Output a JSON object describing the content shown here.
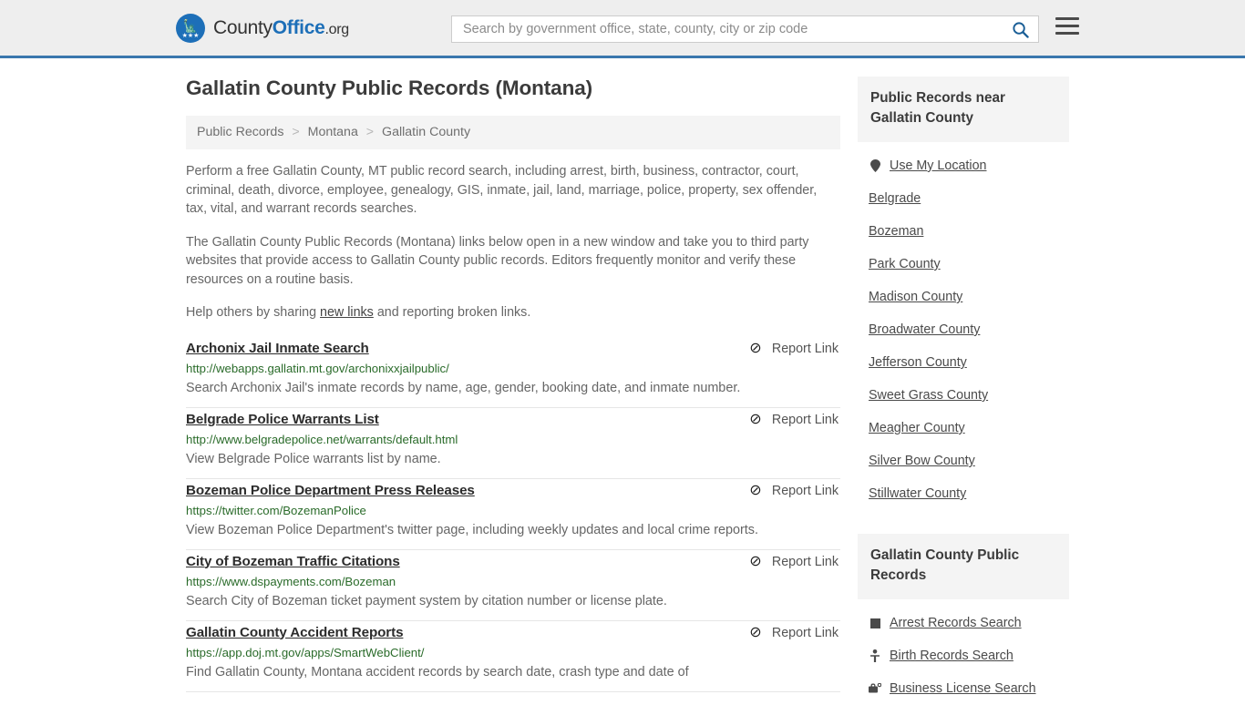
{
  "header": {
    "brand": {
      "part1": "County",
      "part2": "Office",
      "part3": ".org",
      "logo_icon": "eagle-seal-icon",
      "stars": "★★★"
    },
    "search": {
      "value": "",
      "placeholder": "Search by government office, state, county, city or zip code",
      "search_icon": "search-icon"
    },
    "menu_icon": "hamburger-menu-icon",
    "accent_color": "#3a77ad"
  },
  "main": {
    "title": "Gallatin County Public Records (Montana)",
    "breadcrumb": [
      {
        "label": "Public Records"
      },
      {
        "label": "Montana"
      },
      {
        "label": "Gallatin County"
      }
    ],
    "breadcrumb_separator": ">",
    "paragraphs": {
      "p1": "Perform a free Gallatin County, MT public record search, including arrest, birth, business, contractor, court, criminal, death, divorce, employee, genealogy, GIS, inmate, jail, land, marriage, police, property, sex offender, tax, vital, and warrant records searches.",
      "p2": "The Gallatin County Public Records (Montana) links below open in a new window and take you to third party websites that provide access to Gallatin County public records. Editors frequently monitor and verify these resources on a routine basis.",
      "p3_before": "Help others by sharing ",
      "p3_link": "new links",
      "p3_after": " and reporting broken links."
    },
    "report_link_label": "Report Link",
    "report_link_icon": "broken-link-icon",
    "listings": [
      {
        "title": "Archonix Jail Inmate Search",
        "url": "http://webapps.gallatin.mt.gov/archonixxjailpublic/",
        "description": "Search Archonix Jail's inmate records by name, age, gender, booking date, and inmate number."
      },
      {
        "title": "Belgrade Police Warrants List",
        "url": "http://www.belgradepolice.net/warrants/default.html",
        "description": "View Belgrade Police warrants list by name."
      },
      {
        "title": "Bozeman Police Department Press Releases",
        "url": "https://twitter.com/BozemanPolice",
        "description": "View Bozeman Police Department's twitter page, including weekly updates and local crime reports."
      },
      {
        "title": "City of Bozeman Traffic Citations",
        "url": "https://www.dspayments.com/Bozeman",
        "description": "Search City of Bozeman ticket payment system by citation number or license plate."
      },
      {
        "title": "Gallatin County Accident Reports",
        "url": "https://app.doj.mt.gov/apps/SmartWebClient/",
        "description": "Find Gallatin County, Montana accident records by search date, crash type and date of"
      }
    ]
  },
  "sidebar": {
    "near_panel": {
      "title": "Public Records near Gallatin County",
      "items": [
        {
          "label": "Use My Location",
          "icon": "map-pin-icon"
        },
        {
          "label": "Belgrade",
          "icon": ""
        },
        {
          "label": "Bozeman",
          "icon": ""
        },
        {
          "label": "Park County",
          "icon": ""
        },
        {
          "label": "Madison County",
          "icon": ""
        },
        {
          "label": "Broadwater County",
          "icon": ""
        },
        {
          "label": "Jefferson County",
          "icon": ""
        },
        {
          "label": "Sweet Grass County",
          "icon": ""
        },
        {
          "label": "Meagher County",
          "icon": ""
        },
        {
          "label": "Silver Bow County",
          "icon": ""
        },
        {
          "label": "Stillwater County",
          "icon": ""
        }
      ]
    },
    "records_panel": {
      "title": "Gallatin County Public Records",
      "items": [
        {
          "label": "Arrest Records Search",
          "icon": "fingerprint-icon"
        },
        {
          "label": "Birth Records Search",
          "icon": "baby-icon"
        },
        {
          "label": "Business License Search",
          "icon": "briefcase-icon"
        }
      ]
    }
  }
}
